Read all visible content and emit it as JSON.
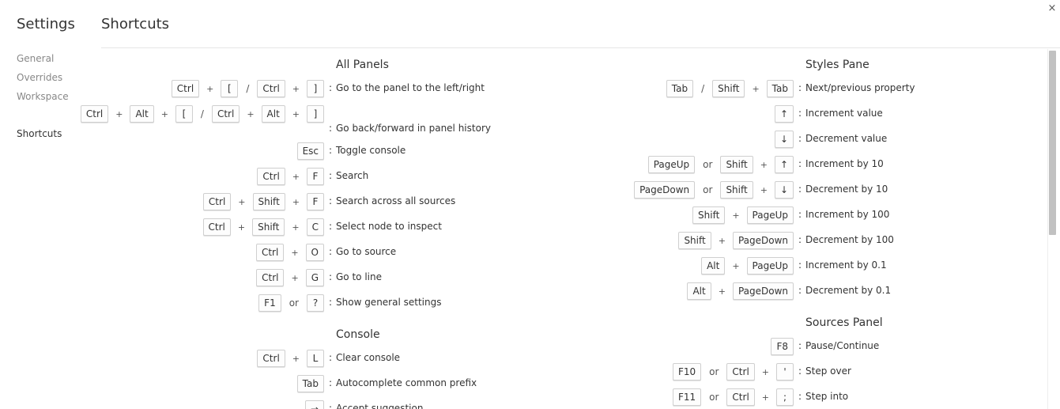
{
  "window": {
    "close_glyph": "×"
  },
  "sidebar": {
    "title": "Settings",
    "items": [
      {
        "label": "General"
      },
      {
        "label": "Overrides"
      },
      {
        "label": "Workspace"
      },
      {
        "label": "Shortcuts"
      }
    ]
  },
  "main": {
    "title": "Shortcuts"
  },
  "sections": {
    "all_panels": {
      "title": "All Panels",
      "rows": [
        {
          "keys": [
            [
              "Ctrl",
              "+",
              "["
            ],
            [
              "Ctrl",
              "+",
              "]"
            ]
          ],
          "desc": "Go to the panel to the left/right"
        },
        {
          "keys": [
            [
              "Ctrl",
              "+",
              "Alt",
              "+",
              "["
            ],
            [
              "Ctrl",
              "+",
              "Alt",
              "+",
              "]"
            ]
          ],
          "desc": "Go back/forward in panel history"
        },
        {
          "keys": [
            [
              "Esc"
            ]
          ],
          "desc": "Toggle console"
        },
        {
          "keys": [
            [
              "Ctrl",
              "+",
              "F"
            ]
          ],
          "desc": "Search"
        },
        {
          "keys": [
            [
              "Ctrl",
              "+",
              "Shift",
              "+",
              "F"
            ]
          ],
          "desc": "Search across all sources"
        },
        {
          "keys": [
            [
              "Ctrl",
              "+",
              "Shift",
              "+",
              "C"
            ]
          ],
          "desc": "Select node to inspect"
        },
        {
          "keys": [
            [
              "Ctrl",
              "+",
              "O"
            ]
          ],
          "desc": "Go to source"
        },
        {
          "keys": [
            [
              "Ctrl",
              "+",
              "G"
            ]
          ],
          "desc": "Go to line"
        },
        {
          "keys": [
            [
              "F1"
            ],
            [
              "?"
            ]
          ],
          "desc": "Show general settings",
          "joiner": "or"
        }
      ]
    },
    "console": {
      "title": "Console",
      "rows": [
        {
          "keys": [
            [
              "Ctrl",
              "+",
              "L"
            ]
          ],
          "desc": "Clear console"
        },
        {
          "keys": [
            [
              "Tab"
            ]
          ],
          "desc": "Autocomplete common prefix"
        },
        {
          "keys": [
            [
              "→"
            ]
          ],
          "desc": "Accept suggestion"
        }
      ]
    },
    "styles_pane": {
      "title": "Styles Pane",
      "rows": [
        {
          "keys": [
            [
              "Tab"
            ],
            [
              "Shift",
              "+",
              "Tab"
            ]
          ],
          "desc": "Next/previous property"
        },
        {
          "keys": [
            [
              "↑"
            ]
          ],
          "desc": "Increment value"
        },
        {
          "keys": [
            [
              "↓"
            ]
          ],
          "desc": "Decrement value"
        },
        {
          "keys": [
            [
              "PageUp"
            ],
            [
              "Shift",
              "+",
              "↑"
            ]
          ],
          "desc": "Increment by 10",
          "joiner": "or"
        },
        {
          "keys": [
            [
              "PageDown"
            ],
            [
              "Shift",
              "+",
              "↓"
            ]
          ],
          "desc": "Decrement by 10",
          "joiner": "or"
        },
        {
          "keys": [
            [
              "Shift",
              "+",
              "PageUp"
            ]
          ],
          "desc": "Increment by 100"
        },
        {
          "keys": [
            [
              "Shift",
              "+",
              "PageDown"
            ]
          ],
          "desc": "Decrement by 100"
        },
        {
          "keys": [
            [
              "Alt",
              "+",
              "PageUp"
            ]
          ],
          "desc": "Increment by 0.1"
        },
        {
          "keys": [
            [
              "Alt",
              "+",
              "PageDown"
            ]
          ],
          "desc": "Decrement by 0.1"
        }
      ]
    },
    "sources_panel": {
      "title": "Sources Panel",
      "rows": [
        {
          "keys": [
            [
              "F8"
            ]
          ],
          "desc": "Pause/Continue"
        },
        {
          "keys": [
            [
              "F10"
            ],
            [
              "Ctrl",
              "+",
              "'"
            ]
          ],
          "desc": "Step over",
          "joiner": "or"
        },
        {
          "keys": [
            [
              "F11"
            ],
            [
              "Ctrl",
              "+",
              ";"
            ]
          ],
          "desc": "Step into",
          "joiner": "or"
        }
      ]
    }
  }
}
